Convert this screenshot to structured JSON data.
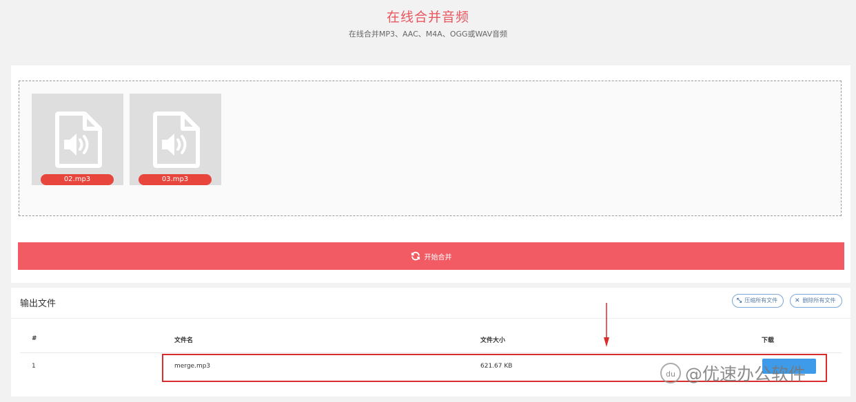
{
  "header": {
    "title": "在线合并音频",
    "subtitle": "在线合并MP3、AAC、M4A、OGG或WAV音频"
  },
  "upload": {
    "files": [
      {
        "name": "02.mp3",
        "icon": "audio-file-icon"
      },
      {
        "name": "03.mp3",
        "icon": "audio-file-icon"
      }
    ],
    "merge_button": {
      "label": "开始合并",
      "icon": "refresh-icon"
    }
  },
  "output": {
    "title": "输出文件",
    "compress_all_label": "压缩所有文件",
    "delete_all_label": "删除所有文件",
    "table": {
      "columns": [
        "#",
        "文件名",
        "文件大小",
        "下载"
      ],
      "rows": [
        {
          "index": "1",
          "filename": "merge.mp3",
          "size": "621.67 KB"
        }
      ]
    }
  },
  "watermark": {
    "text": "@优速办公软件",
    "logo": "du"
  },
  "colors": {
    "accent": "#f35b64",
    "title_red": "#e8565e",
    "file_tag": "#e8453c",
    "download_blue": "#3d9be9",
    "annotation_red": "#d92d2d"
  }
}
